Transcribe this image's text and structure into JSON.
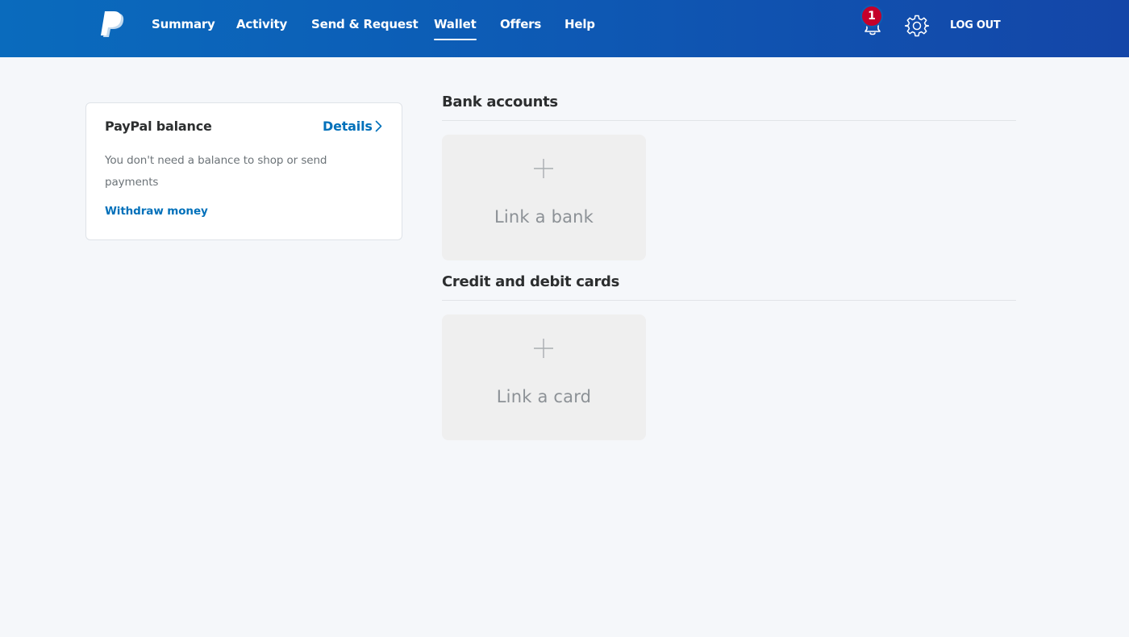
{
  "nav": {
    "items": [
      {
        "label": "Summary",
        "active": false
      },
      {
        "label": "Activity",
        "active": false
      },
      {
        "label": "Send & Request",
        "active": false
      },
      {
        "label": "Wallet",
        "active": true
      },
      {
        "label": "Offers",
        "active": false
      },
      {
        "label": "Help",
        "active": false
      }
    ],
    "notification_count": "1",
    "logout_label": "LOG OUT"
  },
  "balance": {
    "title": "PayPal balance",
    "details_label": "Details",
    "description": "You don't need a balance to shop or send payments",
    "withdraw_label": "Withdraw money"
  },
  "bank_accounts": {
    "title": "Bank accounts",
    "link_label": "Link a bank"
  },
  "cards": {
    "title": "Credit and debit cards",
    "link_label": "Link a card"
  },
  "colors": {
    "header_start": "#0a6bbd",
    "header_end": "#1446a8",
    "link": "#0070ba",
    "badge": "#c4002b",
    "background": "#f5f7fa",
    "tile": "#efefef"
  },
  "icons": [
    "paypal-logo",
    "bell-icon",
    "gear-icon",
    "chevron-right-icon",
    "plus-icon"
  ]
}
